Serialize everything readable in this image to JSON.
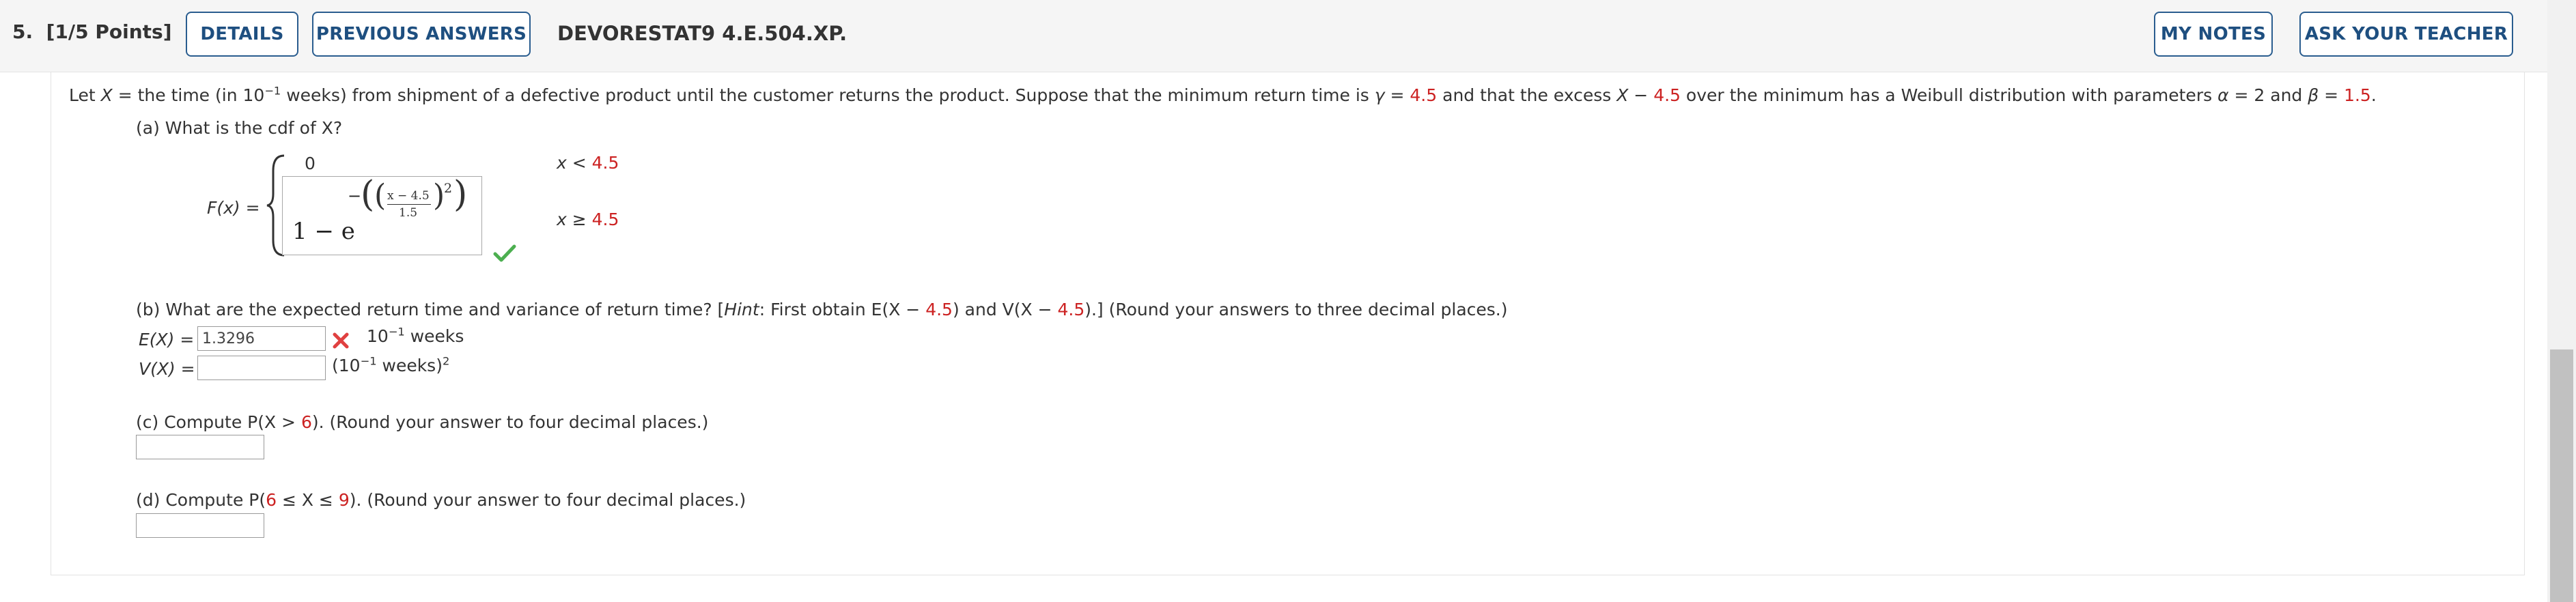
{
  "question": {
    "number": "5.",
    "points": "[1/5 Points]",
    "code": "DEVORESTAT9 4.E.504.XP."
  },
  "buttons": {
    "details": "DETAILS",
    "previous_answers": "PREVIOUS ANSWERS",
    "my_notes": "MY NOTES",
    "ask_teacher": "ASK YOUR TEACHER"
  },
  "intro": {
    "t1": "Let ",
    "X": "X",
    "t2": " = the time (in 10",
    "exp": "−1",
    "t3": " weeks) from shipment of a defective product until the customer returns the product. Suppose that the minimum return time is ",
    "gamma": "γ",
    "t4": " = ",
    "gamma_val": "4.5",
    "t5": " and that the excess ",
    "t6": " − ",
    "excess_val": "4.5",
    "t7": " over the minimum has a Weibull distribution with parameters ",
    "alpha": "α",
    "t8": " = 2 and ",
    "beta": "β",
    "t9": " = ",
    "beta_val": "1.5",
    "t10": "."
  },
  "part_a": {
    "question": "(a) What is the cdf of X?",
    "lhs": "F(x) =",
    "case1_value": "0",
    "case1_cond_pre": "x < ",
    "case1_cond_val": "4.5",
    "formula_one": "1 − e",
    "formula_minus": "−",
    "formula_num": "x − 4.5",
    "formula_den": "1.5",
    "formula_exp": "2",
    "case2_cond_pre": "x ≥ ",
    "case2_cond_val": "4.5",
    "status": "correct"
  },
  "part_b": {
    "q1": "(b) What are the expected return time and variance of return time? [",
    "hint": "Hint",
    "q2": ": First obtain  E(X − ",
    "v1": "4.5",
    "q3": ")  and  V(X − ",
    "v2": "4.5",
    "q4": ").]  (Round your answers to three decimal places.)",
    "ex_label": "E(X) =",
    "ex_value": "1.3296",
    "ex_status": "incorrect",
    "ex_unit_pre": "10",
    "ex_unit_exp": "−1",
    "ex_unit_post": " weeks",
    "vx_label": "V(X) =",
    "vx_value": "",
    "vx_unit_pre": "(10",
    "vx_unit_exp": "−1",
    "vx_unit_post": " weeks)",
    "vx_unit_exp2": "2"
  },
  "part_c": {
    "q1": "(c) Compute  P(X > ",
    "val": "6",
    "q2": ").  (Round your answer to four decimal places.)",
    "answer": ""
  },
  "part_d": {
    "q1": "(d) Compute  P(",
    "v1": "6",
    "mid": " ≤ X ≤ ",
    "v2": "9",
    "q2": ").  (Round your answer to four decimal places.)",
    "answer": ""
  },
  "colors": {
    "accent": "#2a5d8f",
    "highlight": "#cc2222",
    "correct": "#4caf50",
    "incorrect": "#e04040"
  }
}
